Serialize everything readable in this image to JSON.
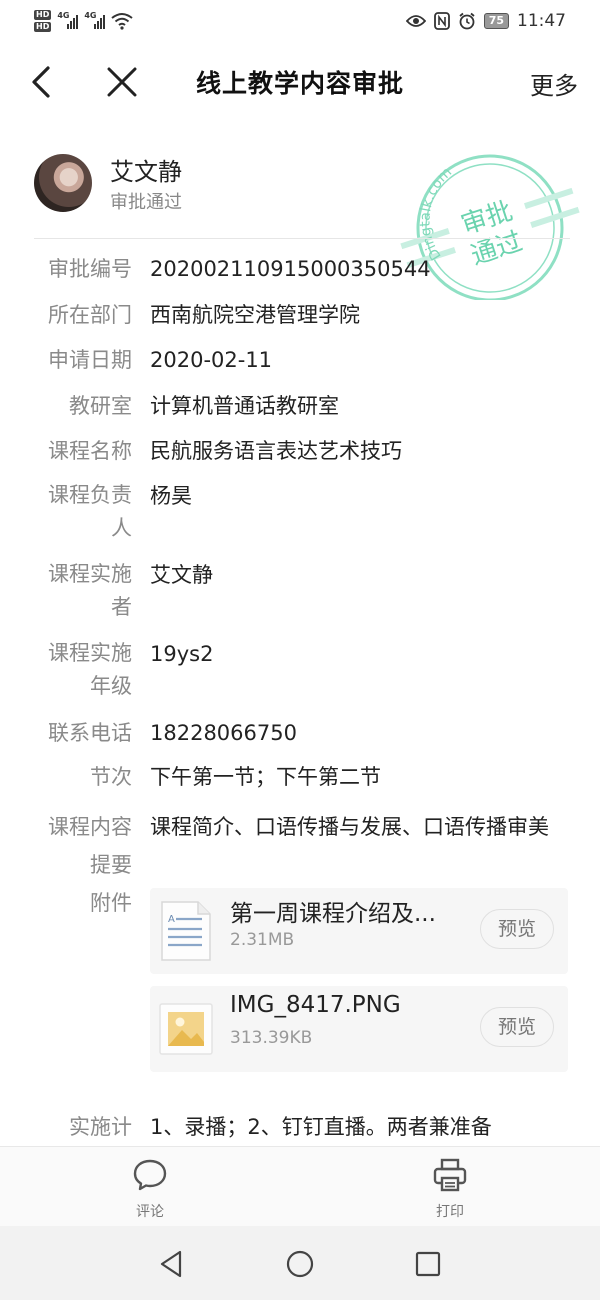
{
  "status_bar": {
    "hd1": "HD",
    "hd2": "HD",
    "net1": "4G",
    "net2": "4G",
    "battery": "75",
    "time": "11:47"
  },
  "nav": {
    "title": "线上教学内容审批",
    "more": "更多"
  },
  "applicant": {
    "name": "艾文静",
    "status": "审批通过"
  },
  "stamp": {
    "brand": "Dingtalk.com",
    "line1": "审批",
    "line2": "通过",
    "color": "#5fcfa8"
  },
  "fields": {
    "approval_no": {
      "label": "审批编号",
      "value": "202002110915000350544"
    },
    "department": {
      "label": "所在部门",
      "value": "西南航院空港管理学院"
    },
    "apply_date": {
      "label": "申请日期",
      "value": "2020-02-11"
    },
    "teaching_office": {
      "label": "教研室",
      "value": "计算机普通话教研室"
    },
    "course_name": {
      "label": "课程名称",
      "value": "民航服务语言表达艺术技巧"
    },
    "course_owner": {
      "label": "课程负责人",
      "value": "杨昊"
    },
    "course_implementer": {
      "label": "课程实施者",
      "value": "艾文静"
    },
    "course_grade": {
      "label": "课程实施年级",
      "value": "19ys2"
    },
    "phone": {
      "label": "联系电话",
      "value": "18228066750"
    },
    "sessions": {
      "label": "节次",
      "value": "下午第一节；下午第二节"
    },
    "content_summary": {
      "label": "课程内容提要",
      "value": "课程简介、口语传播与发展、口语传播审美"
    },
    "attachments_label": "附件",
    "plan": {
      "label": "实施计",
      "value": "1、录播；2、钉钉直播。两者兼准备"
    }
  },
  "attachments": [
    {
      "name": "第一周课程介绍及...",
      "size": "2.31MB",
      "preview": "预览",
      "icon": "document-icon"
    },
    {
      "name": "IMG_8417.PNG",
      "size": "313.39KB",
      "preview": "预览",
      "icon": "image-icon"
    }
  ],
  "actions": {
    "comment": "评论",
    "print": "打印"
  }
}
